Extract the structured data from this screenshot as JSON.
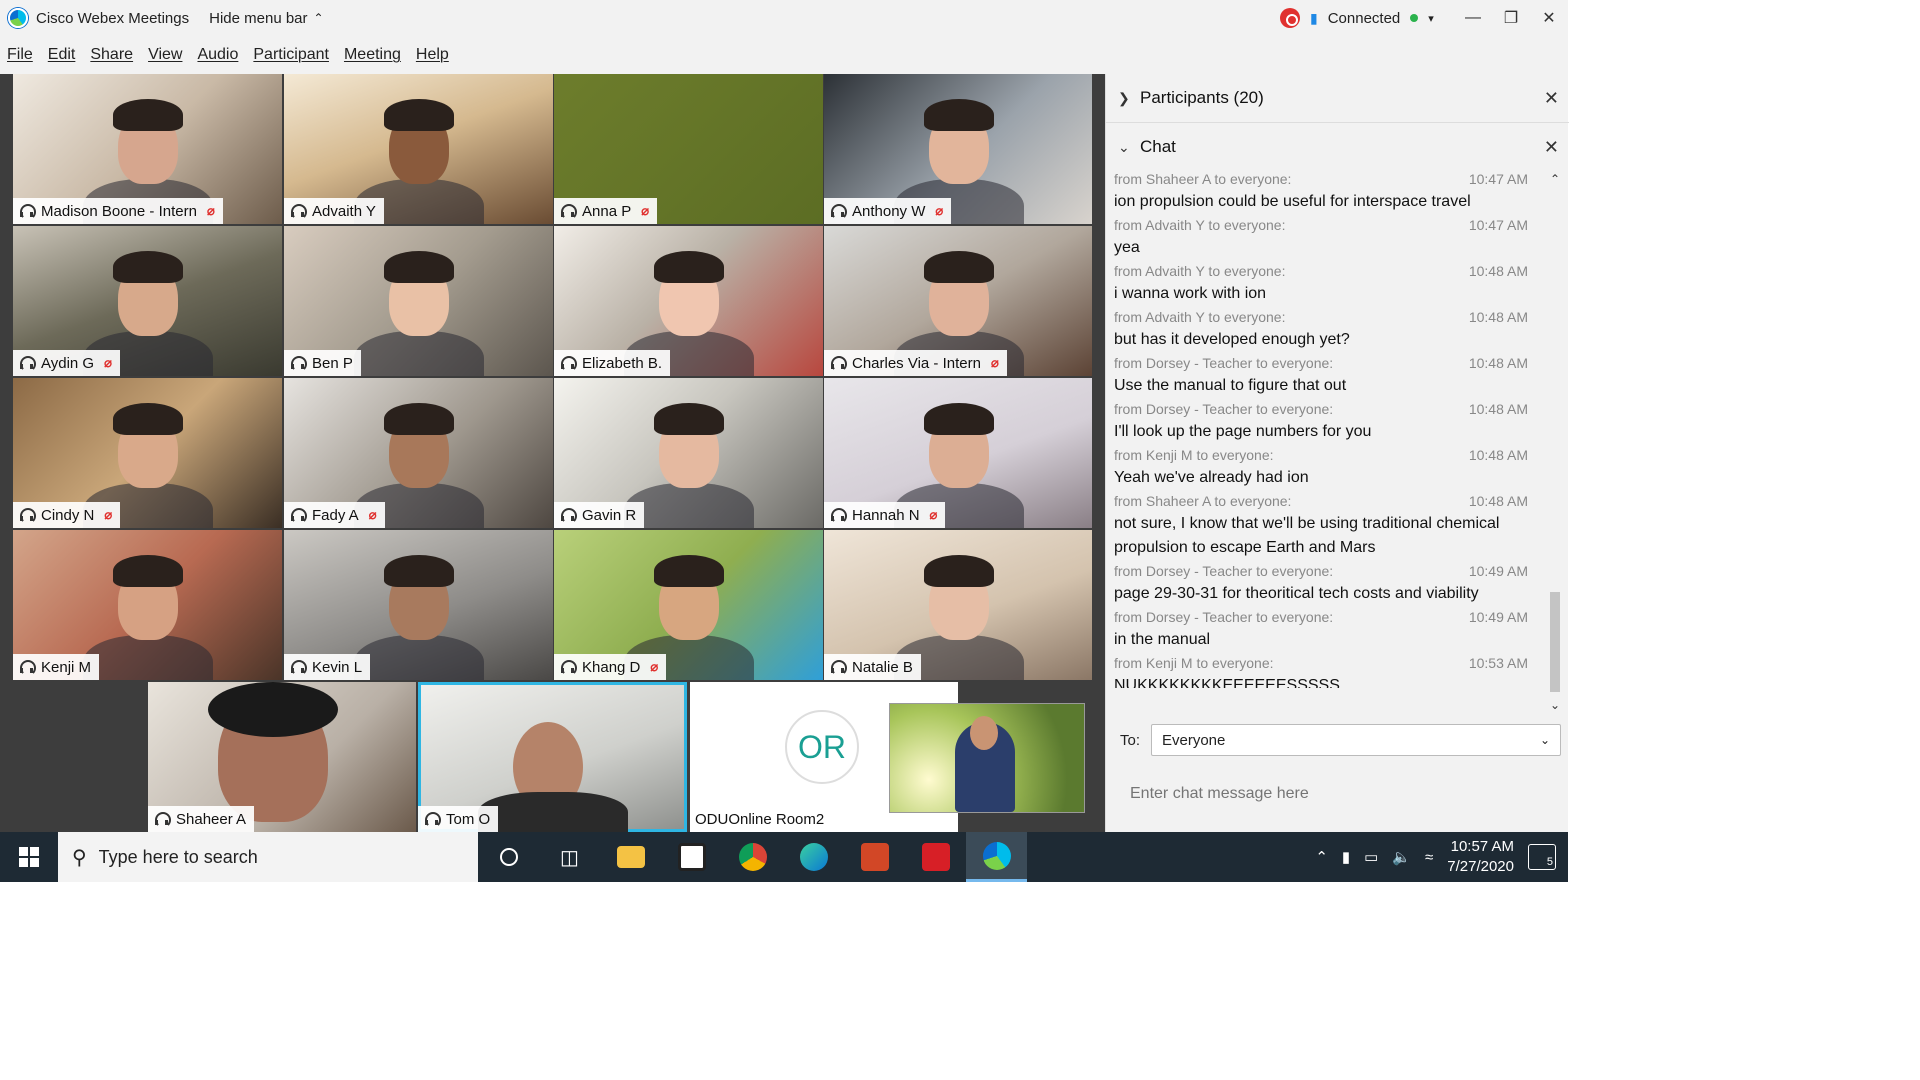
{
  "title_bar": {
    "app_title": "Cisco Webex Meetings",
    "hide_menu_label": "Hide menu bar",
    "connection_status": "Connected"
  },
  "menu": [
    "File",
    "Edit",
    "Share",
    "View",
    "Audio",
    "Participant",
    "Meeting",
    "Help"
  ],
  "participants": [
    {
      "name": "Madison Boone - Intern",
      "muted": true
    },
    {
      "name": "Advaith Y",
      "muted": false
    },
    {
      "name": "Anna P",
      "muted": true
    },
    {
      "name": "Anthony W",
      "muted": true
    },
    {
      "name": "Aydin G",
      "muted": true
    },
    {
      "name": "Ben P",
      "muted": false
    },
    {
      "name": "Elizabeth B.",
      "muted": false
    },
    {
      "name": "Charles Via - Intern",
      "muted": true
    },
    {
      "name": "Cindy N",
      "muted": true
    },
    {
      "name": "Fady A",
      "muted": true
    },
    {
      "name": "Gavin R",
      "muted": false
    },
    {
      "name": "Hannah N",
      "muted": true
    },
    {
      "name": "Kenji M",
      "muted": false
    },
    {
      "name": "Kevin L",
      "muted": false
    },
    {
      "name": "Khang D",
      "muted": true
    },
    {
      "name": "Natalie B",
      "muted": false
    }
  ],
  "bottom_row": {
    "shaheer": "Shaheer A",
    "tom": "Tom O",
    "odu_initials": "OR",
    "odu_name": "ODUOnline Room2"
  },
  "panel": {
    "participants_header": "Participants (20)",
    "chat_header": "Chat",
    "to_label": "To:",
    "to_value": "Everyone",
    "input_placeholder": "Enter chat message here"
  },
  "chat": [
    {
      "from": "from Shaheer A to everyone:",
      "time": "10:47 AM",
      "text": "ion propulsion could be useful for interspace travel"
    },
    {
      "from": "from Advaith Y to everyone:",
      "time": "10:47 AM",
      "text": "yea"
    },
    {
      "from": "from Advaith Y to everyone:",
      "time": "10:48 AM",
      "text": "i wanna work with ion"
    },
    {
      "from": "from Advaith Y to everyone:",
      "time": "10:48 AM",
      "text": "but has it developed enough yet?"
    },
    {
      "from": "from Dorsey - Teacher to everyone:",
      "time": "10:48 AM",
      "text": "Use the manual to figure that out"
    },
    {
      "from": "from Dorsey - Teacher to everyone:",
      "time": "10:48 AM",
      "text": "I'll look up the page numbers for you"
    },
    {
      "from": "from Kenji M to everyone:",
      "time": "10:48 AM",
      "text": "Yeah we've already had ion"
    },
    {
      "from": "from Shaheer A to everyone:",
      "time": "10:48 AM",
      "text": "not sure, I know that we'll be using traditional chemical propulsion to escape Earth and Mars"
    },
    {
      "from": "from Dorsey - Teacher to everyone:",
      "time": "10:49 AM",
      "text": "page 29-30-31 for theoritical tech costs and viability"
    },
    {
      "from": "from Dorsey - Teacher to everyone:",
      "time": "10:49 AM",
      "text": "in the manual"
    },
    {
      "from": "from Kenji M to everyone:",
      "time": "10:53 AM",
      "text": "NUKKKKKKKKEEEEEESSSSS"
    }
  ],
  "taskbar": {
    "search_placeholder": "Type here to search",
    "time": "10:57 AM",
    "date": "7/27/2020",
    "notification_count": "5"
  }
}
